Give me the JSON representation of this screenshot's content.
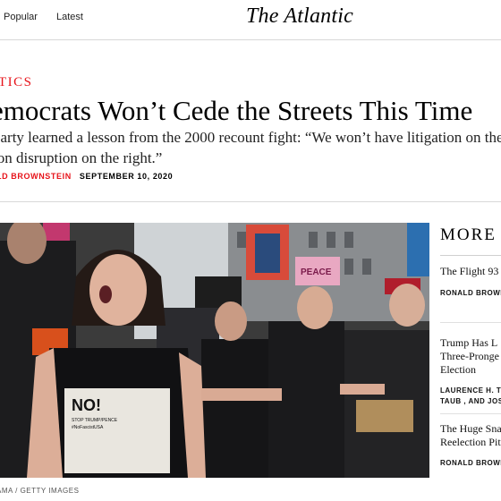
{
  "nav": {
    "links": [
      "Popular",
      "Latest"
    ],
    "logo": "The Atlantic"
  },
  "article": {
    "section": "TICS",
    "headline": "emocrats Won’t Cede the Streets This Time",
    "dek_lines": [
      "party learned a lesson from the 2000 recount fight: “We won’t have litigation on the le",
      "ion disruption on the right.”"
    ],
    "author": "LD BROWNSTEIN",
    "date": "SEPTEMBER 10, 2020",
    "photo_credit": "AMA / GETTY IMAGES",
    "photo_sign_text": [
      "NO!",
      "STOP TRUMP/PENCE",
      "#NoFascistUSA",
      "PEACE"
    ]
  },
  "sidebar": {
    "title": "MORE S",
    "stories": [
      {
        "title_lines": [
          "The Flight 93"
        ],
        "author_lines": [
          "RONALD BROWN"
        ]
      },
      {
        "title_lines": [
          "Trump Has L",
          "Three-Pronge",
          "Election"
        ],
        "author_lines": [
          "LAURENCE H. T",
          "TAUB , AND JOS"
        ]
      },
      {
        "title_lines": [
          "The Huge Sna",
          "Reelection Pit"
        ],
        "author_lines": [
          "RONALD BROWN"
        ]
      }
    ]
  }
}
